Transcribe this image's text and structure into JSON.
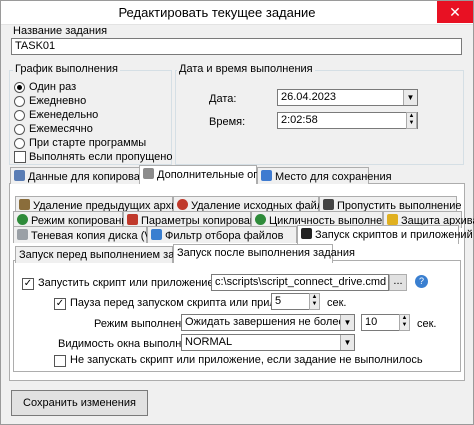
{
  "window": {
    "title": "Редактировать текущее задание",
    "close_glyph": "✕"
  },
  "task_name": {
    "label": "Название задания",
    "value": "TASK01"
  },
  "schedule": {
    "label": "График выполнения",
    "options": [
      "Один раз",
      "Ежедневно",
      "Еженедельно",
      "Ежемесячно",
      "При старте программы"
    ],
    "selected": "Один раз",
    "run_if_missed": "Выполнять если пропущено"
  },
  "datetime": {
    "label": "Дата и время выполнения",
    "date_label": "Дата:",
    "date_value": "26.04.2023",
    "time_label": "Время:",
    "time_value": "2:02:58"
  },
  "main_tabs": [
    "Данные для копирования",
    "Дополнительные опции",
    "Место для сохранения"
  ],
  "option_tabs": {
    "row1": [
      "Удаление предыдущих архивов",
      "Удаление исходных файлов",
      "Пропустить выполнение"
    ],
    "row2": [
      "Режим копирования",
      "Параметры копирования",
      "Цикличность выполнения",
      "Защита архива"
    ],
    "row3": [
      "Теневая копия диска (VSS)",
      "Фильтр отбора файлов",
      "Запуск скриптов и приложений"
    ]
  },
  "script_tabs": [
    "Запуск перед выполнением задания",
    "Запуск после выполнения задания"
  ],
  "script": {
    "run_label": "Запустить скрипт или приложение:",
    "path": "c:\\scripts\\script_connect_drive.cmd",
    "browse_label": "...",
    "help_glyph": "?",
    "pause_label": "Пауза перед запуском скрипта или приложения:",
    "pause_value": "5",
    "pause_unit": "сек.",
    "mode_label": "Режим выполнения:",
    "mode_value": "Ожидать завершения не более, чем",
    "mode_seconds": "10",
    "mode_unit": "сек.",
    "visibility_label": "Видимость окна выполнения:",
    "visibility_value": "NORMAL",
    "skip_label": "Не запускать скрипт или приложение, если задание не выполнилось"
  },
  "save_button": "Сохранить изменения",
  "colors": {
    "close": "#e81123",
    "tab_icon_red": "#c0392b",
    "tab_icon_green": "#2e8b3a",
    "help_blue": "#3a7fd0"
  }
}
